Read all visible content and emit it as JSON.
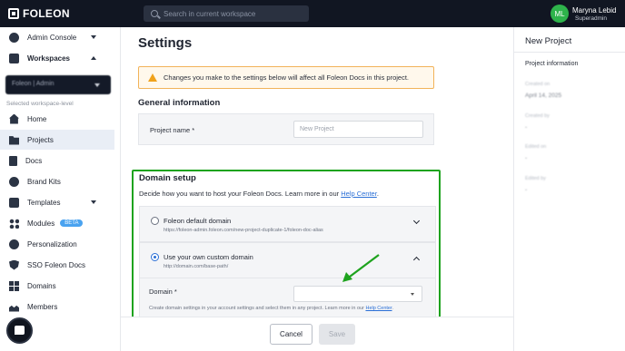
{
  "topbar": {
    "logo": "FOLEON",
    "search_placeholder": "Search in current workspace",
    "user": {
      "initials": "ML",
      "name": "Maryna Lebid",
      "role": "Superadmin"
    }
  },
  "sidebar": {
    "admin_console": "Admin Console",
    "workspaces": "Workspaces",
    "workspace_selected": "Foleon | Admin",
    "workspace_level_label": "Selected workspace-level",
    "items": [
      {
        "label": "Home",
        "icon": "home-icon"
      },
      {
        "label": "Projects",
        "icon": "folder-icon",
        "active": true
      },
      {
        "label": "Docs",
        "icon": "doc-icon"
      },
      {
        "label": "Brand Kits",
        "icon": "palette-icon"
      },
      {
        "label": "Templates",
        "icon": "template-icon"
      },
      {
        "label": "Modules",
        "icon": "modules-icon",
        "badge": "BETA"
      },
      {
        "label": "Personalization",
        "icon": "person-icon"
      },
      {
        "label": "SSO Foleon Docs",
        "icon": "shield-icon"
      },
      {
        "label": "Domains",
        "icon": "domains-icon"
      },
      {
        "label": "Members",
        "icon": "members-icon"
      }
    ]
  },
  "main": {
    "title": "Settings",
    "warning": "Changes you make to the settings below will affect all Foleon Docs in this project.",
    "general_heading": "General information",
    "project_name_label": "Project name *",
    "project_name_placeholder": "New Project",
    "domain": {
      "heading": "Domain setup",
      "subtitle": "Decide how you want to host your Foleon Docs. Learn more in our ",
      "help_link": "Help Center",
      "subtitle_end": ".",
      "option_default_title": "Foleon default domain",
      "option_default_url": "https://foleon-admin.foleon.com/new-project-duplicate-1/foleon-doc-alias",
      "option_custom_title": "Use your own custom domain",
      "option_custom_url": "http://domain.com/base-path/",
      "domain_label": "Domain *",
      "help_text": "Create domain settings in your account settings and select them in any project. Learn more in our ",
      "help_text_link": "Help Center",
      "help_text_end": "."
    }
  },
  "footer": {
    "cancel": "Cancel",
    "save": "Save"
  },
  "panel": {
    "title": "New Project",
    "subtitle": "Project information",
    "created_on_label": "Created on",
    "created_on_value": "April 14, 2025",
    "created_by_label": "Created by",
    "created_by_value": "-",
    "edited_on_label": "Edited on",
    "edited_on_value": "-",
    "edited_by_label": "Edited by",
    "edited_by_value": "-"
  },
  "colors": {
    "accent": "#2a6fd6",
    "highlight": "#1ea31e",
    "warning": "#f0a21c",
    "topbar": "#111622"
  }
}
